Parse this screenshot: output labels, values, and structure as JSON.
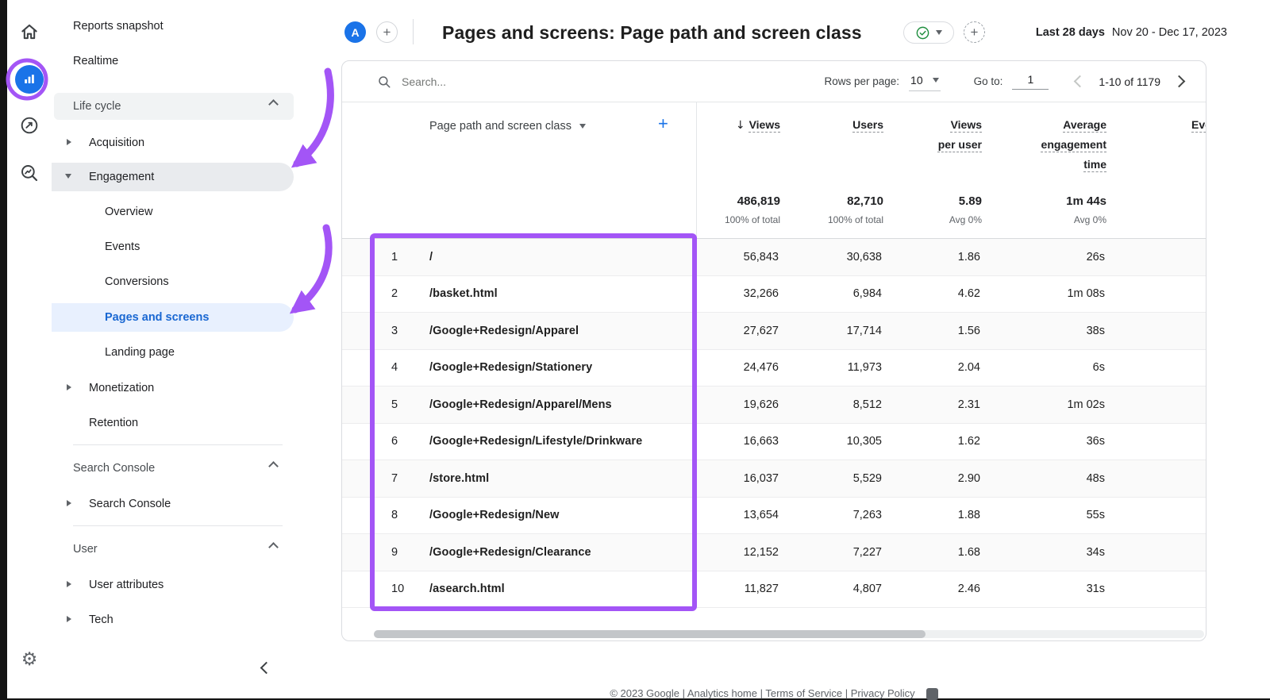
{
  "colors": {
    "annotation_purple": "#a355f6",
    "brand_blue": "#1a73e8",
    "link_blue": "#1967d2",
    "approved_green": "#1e8e3e",
    "selected_item_bg": "#e8f0fe"
  },
  "glyphs": {
    "plus": "+",
    "sort_desc": "↓",
    "gear": "⚙"
  },
  "sidebar": {
    "reports_snapshot": "Reports snapshot",
    "realtime": "Realtime",
    "lifecycle_header": "Life cycle",
    "acquisition": "Acquisition",
    "engagement": "Engagement",
    "engagement_items": [
      "Overview",
      "Events",
      "Conversions",
      "Pages and screens",
      "Landing page"
    ],
    "monetization": "Monetization",
    "retention": "Retention",
    "search_console_header": "Search Console",
    "search_console_item": "Search Console",
    "user_header": "User",
    "user_attributes": "User attributes",
    "tech": "Tech"
  },
  "header": {
    "avatar": "A",
    "title": "Pages and screens: Page path and screen class",
    "range_label": "Last 28 days",
    "range_dates": "Nov 20 - Dec 17, 2023"
  },
  "toolbar": {
    "search_placeholder": "Search...",
    "rows_per_page_label": "Rows per page:",
    "rows_per_page_value": "10",
    "goto_label": "Go to:",
    "goto_value": "1",
    "pagination_text": "1-10 of 1179"
  },
  "table": {
    "dimension_header": "Page path and screen class",
    "columns": [
      {
        "label": "Views",
        "sort": "desc"
      },
      {
        "label": "Users"
      },
      {
        "label": "Views per user"
      },
      {
        "label": "Average engagement time"
      },
      {
        "label": "Event count",
        "clipped": true
      }
    ],
    "totals": {
      "views": "486,819",
      "views_sub": "100% of total",
      "users": "82,710",
      "users_sub": "100% of total",
      "views_per_user": "5.89",
      "views_per_user_sub": "Avg 0%",
      "avg_time": "1m 44s",
      "avg_time_sub": "Avg 0%"
    },
    "rows": [
      {
        "index": "1",
        "path": "/",
        "views": "56,843",
        "users": "30,638",
        "views_per_user": "1.86",
        "avg_time": "26s"
      },
      {
        "index": "2",
        "path": "/basket.html",
        "views": "32,266",
        "users": "6,984",
        "views_per_user": "4.62",
        "avg_time": "1m 08s"
      },
      {
        "index": "3",
        "path": "/Google+Redesign/Apparel",
        "views": "27,627",
        "users": "17,714",
        "views_per_user": "1.56",
        "avg_time": "38s"
      },
      {
        "index": "4",
        "path": "/Google+Redesign/Stationery",
        "views": "24,476",
        "users": "11,973",
        "views_per_user": "2.04",
        "avg_time": "6s"
      },
      {
        "index": "5",
        "path": "/Google+Redesign/Apparel/Mens",
        "views": "19,626",
        "users": "8,512",
        "views_per_user": "2.31",
        "avg_time": "1m 02s"
      },
      {
        "index": "6",
        "path": "/Google+Redesign/Lifestyle/Drinkware",
        "views": "16,663",
        "users": "10,305",
        "views_per_user": "1.62",
        "avg_time": "36s"
      },
      {
        "index": "7",
        "path": "/store.html",
        "views": "16,037",
        "users": "5,529",
        "views_per_user": "2.90",
        "avg_time": "48s"
      },
      {
        "index": "8",
        "path": "/Google+Redesign/New",
        "views": "13,654",
        "users": "7,263",
        "views_per_user": "1.88",
        "avg_time": "55s"
      },
      {
        "index": "9",
        "path": "/Google+Redesign/Clearance",
        "views": "12,152",
        "users": "7,227",
        "views_per_user": "1.68",
        "avg_time": "34s"
      },
      {
        "index": "10",
        "path": "/asearch.html",
        "views": "11,827",
        "users": "4,807",
        "views_per_user": "2.46",
        "avg_time": "31s"
      }
    ]
  },
  "footer": {
    "text": "© 2023 Google | Analytics home | Terms of Service | Privacy Policy"
  }
}
